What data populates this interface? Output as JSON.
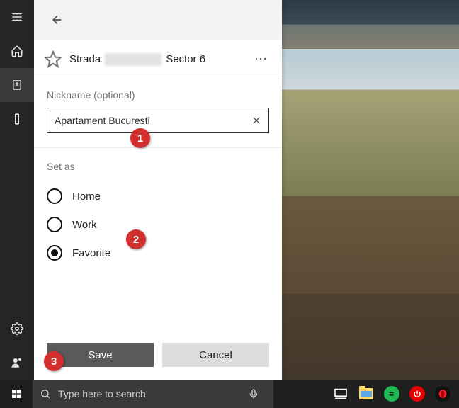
{
  "taskbar": {
    "search_placeholder": "Type here to search"
  },
  "panel": {
    "address_part1": "Strada",
    "address_part2": "Sector 6",
    "nickname_label": "Nickname (optional)",
    "nickname_value": "Apartament Bucuresti",
    "setas_label": "Set as",
    "options": {
      "home": "Home",
      "work": "Work",
      "favorite": "Favorite"
    },
    "selected_option": "favorite",
    "save_label": "Save",
    "cancel_label": "Cancel"
  },
  "callouts": {
    "one": "1",
    "two": "2",
    "three": "3"
  }
}
